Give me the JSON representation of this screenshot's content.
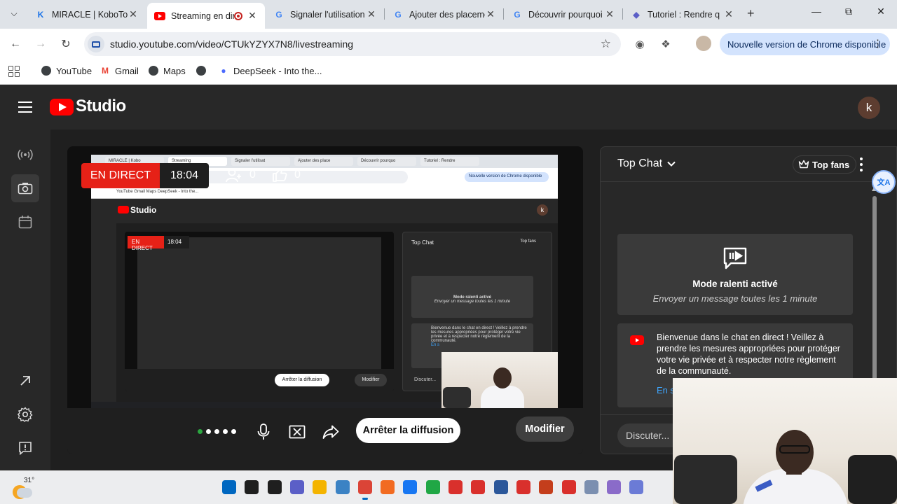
{
  "browser": {
    "tabs": [
      {
        "title": "MIRACLE | KoboToolbox",
        "icon": "kobo-icon"
      },
      {
        "title": "Streaming en direct - YouTube Studio",
        "icon": "youtube-icon",
        "recording": true
      },
      {
        "title": "Signaler l'utilisation",
        "icon": "google-icon"
      },
      {
        "title": "Ajouter des placements",
        "icon": "google-icon"
      },
      {
        "title": "Découvrir pourquoi",
        "icon": "google-icon"
      },
      {
        "title": "Tutoriel : Rendre q",
        "icon": "extension-icon"
      }
    ],
    "url": "studio.youtube.com/video/CTUkYZYX7N8/livestreaming",
    "update_label": "Nouvelle version de Chrome disponible",
    "bookmarks": [
      {
        "label": "YouTube",
        "icon": "globe-icon"
      },
      {
        "label": "Gmail",
        "icon": "gmail-icon"
      },
      {
        "label": "Maps",
        "icon": "globe-icon"
      },
      {
        "label": "",
        "icon": "globe-icon"
      },
      {
        "label": "DeepSeek - Into the...",
        "icon": "deepseek-icon"
      }
    ]
  },
  "studio": {
    "logo_text": "Studio",
    "avatar_letter": "k"
  },
  "live": {
    "status": "EN DIRECT",
    "elapsed": "18:04",
    "viewers": "0",
    "likes": "0"
  },
  "controls": {
    "stop_label": "Arrêter la diffusion",
    "modify_label": "Modifier"
  },
  "chat": {
    "title": "Top Chat",
    "top_fans_label": "Top fans",
    "slow_mode_title": "Mode ralenti activé",
    "slow_mode_sub": "Envoyer un message toutes les 1 minute",
    "welcome_text": "Bienvenue dans le chat en direct ! Veillez à prendre les mesures appropriées pour protéger votre vie privée et à respecter notre règlement de la communauté.",
    "welcome_link": "En s",
    "input_placeholder": "Discuter..."
  },
  "mini": {
    "tabs": [
      "MIRACLE | Kobo",
      "Streaming",
      "Signaler l'utilisat",
      "Ajouter des place",
      "Découvrir pourquo",
      "Tutoriel : Rendre"
    ],
    "update_label": "Nouvelle version de Chrome disponible",
    "bookmarks_line": "YouTube   Gmail   Maps   DeepSeek - Into the...",
    "studio": "Studio",
    "avatar": "k",
    "status": "EN DIRECT",
    "elapsed": "18:04",
    "chat_title": "Top Chat",
    "top_fans": "Top fans",
    "slow_title": "Mode ralenti activé",
    "slow_sub": "Envoyer un message toutes les 1 minute",
    "welcome": "Bienvenue dans le chat en direct ! Veillez à prendre les mesures appropriées pour protéger votre vie privée et à respecter notre règlement de la communauté.",
    "welcome_link": "En s",
    "input": "Discuter...",
    "stop": "Arrêter la diffusion",
    "modify": "Modifier"
  },
  "taskbar": {
    "temperature": "31°",
    "apps": [
      {
        "icon": "windows-start-icon",
        "color": "#0067c0"
      },
      {
        "icon": "search-icon",
        "color": "#1f1f1f"
      },
      {
        "icon": "task-view-icon",
        "color": "#1f1f1f"
      },
      {
        "icon": "teams-icon",
        "color": "#5b5fc7"
      },
      {
        "icon": "file-explorer-icon",
        "color": "#f4b400"
      },
      {
        "icon": "app-icon",
        "color": "#3b82c4"
      },
      {
        "icon": "chrome-icon",
        "color": "#db4437",
        "active": true
      },
      {
        "icon": "app-icon",
        "color": "#f26b21"
      },
      {
        "icon": "facebook-icon",
        "color": "#1877f2"
      },
      {
        "icon": "app-icon",
        "color": "#20a745"
      },
      {
        "icon": "wps-icon",
        "color": "#d9302c"
      },
      {
        "icon": "wps-icon",
        "color": "#d9302c"
      },
      {
        "icon": "word-icon",
        "color": "#2b579a"
      },
      {
        "icon": "wps-icon",
        "color": "#d9302c"
      },
      {
        "icon": "powerpoint-icon",
        "color": "#c43e1c"
      },
      {
        "icon": "wps-icon",
        "color": "#d9302c"
      },
      {
        "icon": "app-icon",
        "color": "#7b8fb0"
      },
      {
        "icon": "app-icon",
        "color": "#8a6bc9"
      },
      {
        "icon": "app-icon",
        "color": "#6b7bd6"
      }
    ]
  }
}
